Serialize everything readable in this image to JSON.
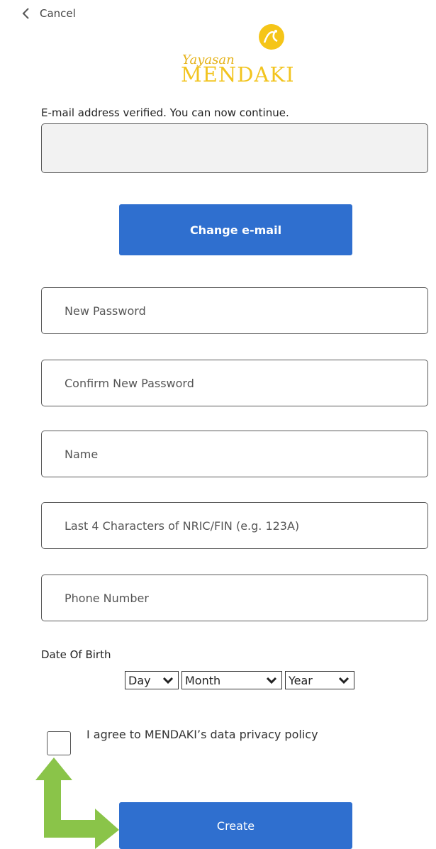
{
  "header": {
    "cancel_label": "Cancel",
    "back_icon": "chevron-left-icon"
  },
  "logo": {
    "line1": "Yayasan",
    "line2": "MENDAKI",
    "color": "#f2c41f"
  },
  "verification": {
    "message": "E-mail address verified. You can now continue.",
    "email_value": ""
  },
  "buttons": {
    "change_email": "Change e-mail",
    "create": "Create",
    "color": "#2f6fcf"
  },
  "fields": {
    "new_password": {
      "placeholder": "New Password",
      "value": ""
    },
    "confirm_password": {
      "placeholder": "Confirm New Password",
      "value": ""
    },
    "name": {
      "placeholder": "Name",
      "value": ""
    },
    "nric": {
      "placeholder": "Last 4 Characters of NRIC/FIN (e.g. 123A)",
      "value": ""
    },
    "phone": {
      "placeholder": "Phone Number",
      "value": ""
    }
  },
  "dob": {
    "label": "Date Of Birth",
    "day": "Day",
    "month": "Month",
    "year": "Year"
  },
  "privacy": {
    "label": "I agree to MENDAKI’s data privacy policy",
    "checked": false
  },
  "annotation": {
    "arrow_color": "#8ac449",
    "icon": "arrow-annotation-icon"
  }
}
